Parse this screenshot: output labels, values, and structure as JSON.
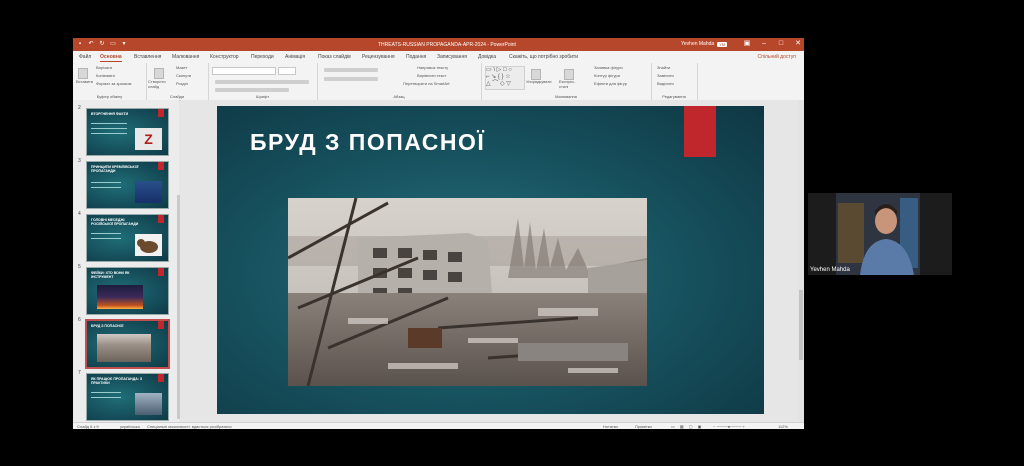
{
  "titlebar": {
    "title": "THREATS-RUSSIAN PROPAGANDA-APR-2024 - PowerPoint",
    "user": "Yevhen Mahda",
    "user_initials": "YM"
  },
  "tabs": [
    "Файл",
    "Основна",
    "Вставлення",
    "Малювання",
    "Конструктор",
    "Переходи",
    "Анімація",
    "Показ слайдів",
    "Рецензування",
    "Подання",
    "Записування",
    "Довідка",
    "Скажіть, що потрібно зробити"
  ],
  "share_label": "Спільний доступ",
  "ribbon": {
    "groups": [
      "Буфер обміну",
      "Слайди",
      "Шрифт",
      "Абзац",
      "Малювання",
      "Редагування"
    ],
    "paste_label": "Вставити",
    "clipboard_items": [
      "Вирізати",
      "Копіювати",
      "Формат за зразком"
    ],
    "new_slide_label": "Створити слайд",
    "slides_items": [
      "Макет",
      "Скинути",
      "Розділ"
    ],
    "paragraph_items": [
      "Напрямок тексту",
      "Вирівняти текст",
      "Перетворити на SmartArt"
    ],
    "arrange_label": "Упорядкувати",
    "quick_styles_label": "Експрес-стилі",
    "shape_items": [
      "Заливка фігури",
      "Контур фігури",
      "Ефекти для фігур"
    ],
    "editing_items": [
      "Знайти",
      "Замінити",
      "Виділити"
    ]
  },
  "thumbnails": [
    {
      "num": "2",
      "title": "ВТОРГНЕННЯ ФАКТИ"
    },
    {
      "num": "3",
      "title": "ПРИНЦИПИ КРЕМЛІВСЬКОЇ ПРОПАГАНДИ"
    },
    {
      "num": "4",
      "title": "ГОЛОВНІ МЕСЕДЖІ РОСІЙСЬКОЇ ПРОПАГАНДИ"
    },
    {
      "num": "5",
      "title": "ФЕЙКИ: ХТО ВОНИ ЯК ІНСТРУМЕНТ"
    },
    {
      "num": "6",
      "title": "БРУД З ПОПАСНОЇ"
    },
    {
      "num": "7",
      "title": "ЯК ПРАЦЮЄ ПРОПАГАНДА: З ПРАКТИКИ"
    }
  ],
  "slide": {
    "title": "БРУД З ПОПАСНОЇ"
  },
  "statusbar": {
    "slide_counter": "Слайд 6 з 9",
    "language": "українська",
    "accessibility": "Спеціальні можливості: вдасться розібратися",
    "notes_label": "Нотатки",
    "comments_label": "Примітки",
    "zoom": "112%"
  },
  "video": {
    "name": "Yevhen Mahda"
  },
  "colors": {
    "accent": "#b7472a",
    "slide_bg": "#17525f",
    "slide_red": "#c0272d"
  }
}
